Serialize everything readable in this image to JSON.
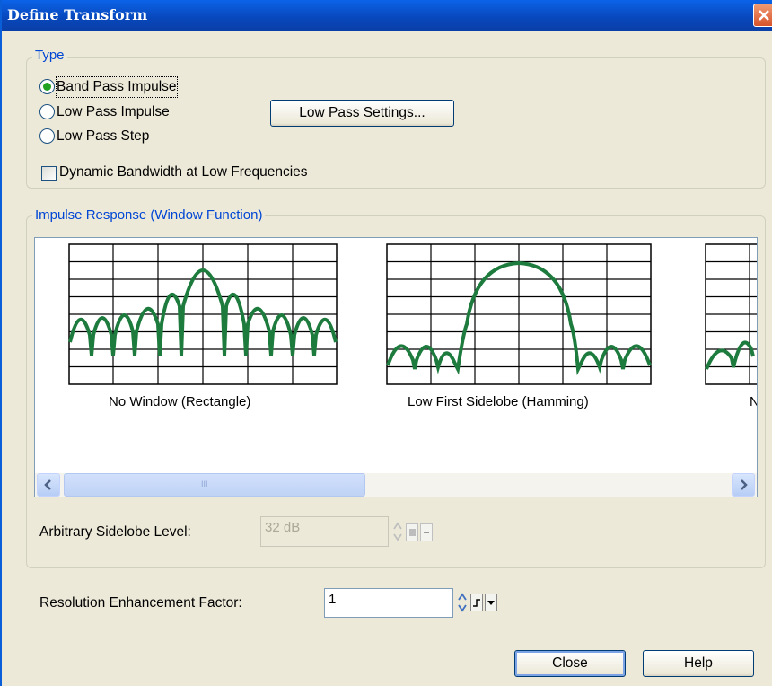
{
  "window": {
    "title": "Define Transform"
  },
  "type_group": {
    "label": "Type",
    "options": [
      {
        "label": "Band Pass Impulse",
        "selected": true
      },
      {
        "label": "Low Pass Impulse",
        "selected": false
      },
      {
        "label": "Low Pass Step",
        "selected": false
      }
    ],
    "low_pass_settings_button": "Low Pass Settings...",
    "dynamic_bandwidth": {
      "label": "Dynamic Bandwidth at Low Frequencies",
      "checked": false
    }
  },
  "impulse_group": {
    "label": "Impulse Response (Window Function)",
    "windows": [
      {
        "caption": "No Window (Rectangle)"
      },
      {
        "caption": "Low First Sidelobe (Hamming)"
      },
      {
        "caption": "N"
      }
    ],
    "scrollbar": {
      "thumb_grip": "III"
    },
    "arbitrary_sidelobe": {
      "label": "Arbitrary Sidelobe Level:",
      "value": "32 dB",
      "enabled": false
    }
  },
  "resolution": {
    "label": "Resolution Enhancement Factor:",
    "value": "1"
  },
  "buttons": {
    "close": "Close",
    "help": "Help"
  },
  "colors": {
    "trace": "#1e7b3e",
    "accent": "#0046d5",
    "titlebar": "#0a55d8"
  }
}
